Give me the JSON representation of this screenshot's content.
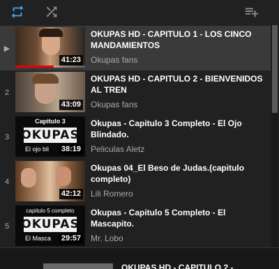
{
  "toolbar": {
    "loop_icon": "repeat-icon",
    "shuffle_icon": "shuffle-icon",
    "save_icon": "playlist-add-icon",
    "accent": "#3ea6ff"
  },
  "playlist": {
    "items": [
      {
        "index": "▶",
        "title": "OKUPAS HD - CAPITULO 1 - LOS CINCO MANDAMIENTOS",
        "channel": "Okupas fans",
        "duration": "41:23",
        "progress": 0.55,
        "active": true
      },
      {
        "index": "2",
        "title": "OKUPAS HD - CAPITULO 2 - BIENVENIDOS AL TREN",
        "channel": "Okupas fans",
        "duration": "43:09"
      },
      {
        "index": "3",
        "title": "Okupas - Capitulo 3 Completo - El Ojo Blindado.",
        "channel": "Peliculas Aletz",
        "duration": "38:19",
        "thumb_caption": "Capitulo 3",
        "thumb_logo": "OKUPAS",
        "thumb_sub": "El ojo bli"
      },
      {
        "index": "4",
        "title": "Okupas 04_El Beso de Judas.(capitulo completo)",
        "channel": "Lili Romero",
        "duration": "42:12"
      },
      {
        "index": "5",
        "title": "Okupas - Capitulo 5 Completo - El Mascapito.",
        "channel": "Mr. Lobo",
        "duration": "29:57",
        "thumb_caption": "capitulo 5 completo",
        "thumb_logo": "OKUPAS",
        "thumb_sub": "El Masca"
      }
    ]
  },
  "below": {
    "title": "OKUPAS HD - CAPITULO 2 -"
  }
}
